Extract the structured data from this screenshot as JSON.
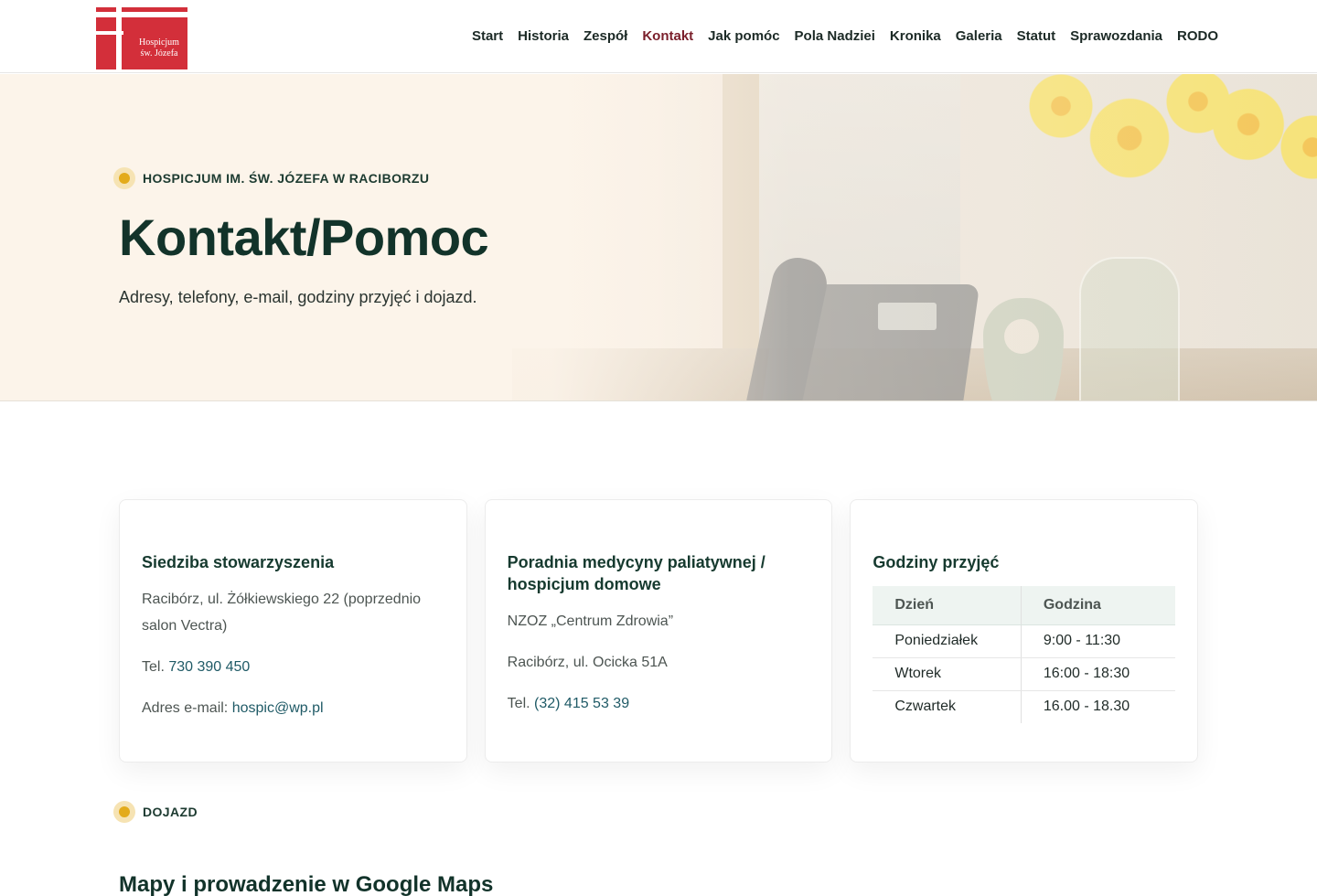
{
  "logo": {
    "line1": "Hospicjum",
    "line2": "św. Józefa"
  },
  "nav": {
    "items": [
      {
        "label": "Start",
        "active": false
      },
      {
        "label": "Historia",
        "active": false
      },
      {
        "label": "Zespół",
        "active": false
      },
      {
        "label": "Kontakt",
        "active": true
      },
      {
        "label": "Jak pomóc",
        "active": false
      },
      {
        "label": "Pola Nadziei",
        "active": false
      },
      {
        "label": "Kronika",
        "active": false
      },
      {
        "label": "Galeria",
        "active": false
      },
      {
        "label": "Statut",
        "active": false
      },
      {
        "label": "Sprawozdania",
        "active": false
      },
      {
        "label": "RODO",
        "active": false
      }
    ]
  },
  "hero": {
    "eyebrow": "HOSPICJUM IM. ŚW. JÓZEFA W RACIBORZU",
    "title": "Kontakt/Pomoc",
    "subtitle": "Adresy, telefony, e-mail, godziny przyjęć i dojazd."
  },
  "cards": {
    "association": {
      "title": "Siedziba stowarzyszenia",
      "address": "Racibórz, ul. Żółkiewskiego 22 (poprzednio salon Vectra)",
      "phone_label": "Tel. ",
      "phone": "730 390 450",
      "email_label": "Adres e-mail: ",
      "email": "hospic@wp.pl"
    },
    "clinic": {
      "title": "Poradnia medycyny paliatywnej / hospicjum domowe",
      "org": "NZOZ „Centrum Zdrowia”",
      "address": "Racibórz, ul. Ocicka 51A",
      "phone_label": "Tel. ",
      "phone": "(32) 415 53 39"
    },
    "hours": {
      "title": "Godziny przyjęć",
      "col_day": "Dzień",
      "col_hour": "Godzina",
      "rows": [
        {
          "day": "Poniedziałek",
          "hour": "9:00 - 11:30"
        },
        {
          "day": "Wtorek",
          "hour": "16:00 - 18:30"
        },
        {
          "day": "Czwartek",
          "hour": "16.00 - 18.30"
        }
      ]
    }
  },
  "directions": {
    "eyebrow": "DOJAZD",
    "title": "Mapy i prowadzenie w Google Maps"
  },
  "colors": {
    "accent": "#7a1f2b",
    "primary": "#12332a",
    "link": "#1f5a66",
    "dot": "#e3ab1b"
  }
}
